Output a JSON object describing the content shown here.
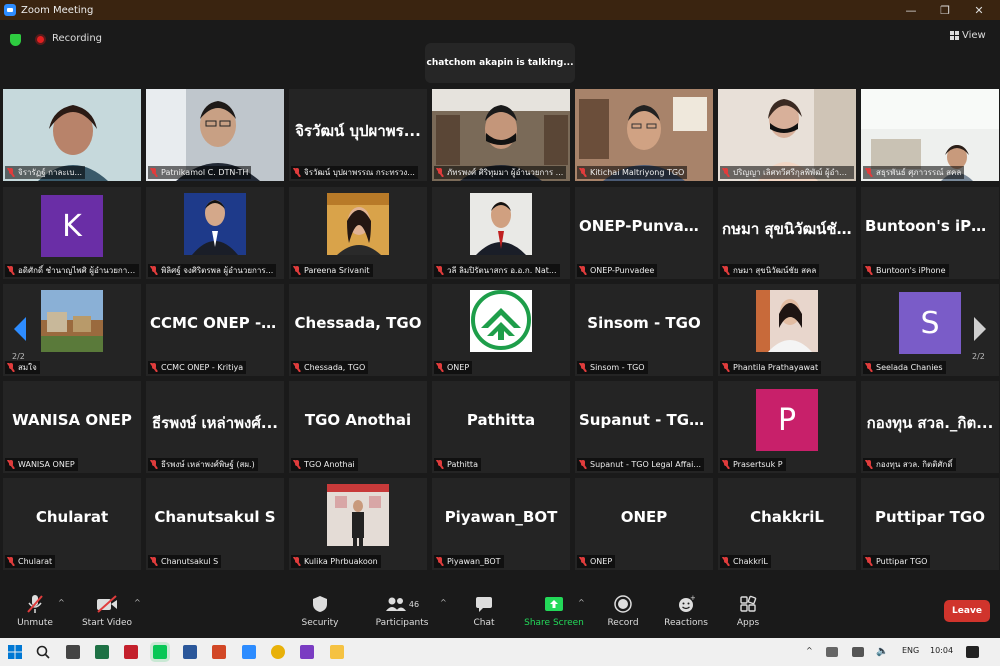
{
  "window": {
    "title": "Zoom Meeting",
    "controls": [
      "—",
      "❐",
      "✕"
    ]
  },
  "status": {
    "recording_label": "Recording",
    "talking": "chatchom akapin is talking...",
    "view_label": "View"
  },
  "pager": {
    "left_page": "2/2",
    "right_page": "2/2"
  },
  "tiles": [
    {
      "label": "จิรารัฏฐ์ กาละเบ...",
      "kind": "video",
      "scene": "woman-teal"
    },
    {
      "label": "Patnikamol C. DTN-TH",
      "kind": "video",
      "scene": "man-glasses"
    },
    {
      "label": "จิรวัฒน์ บุปผาพรรณ กระทรวง...",
      "kind": "name",
      "bigname": "จิรวัฒน์ บุปผาพร..."
    },
    {
      "label": "ภัทรพงศ์ ศิริทุมมา ผู้อำนวยการ ...",
      "kind": "video",
      "scene": "man-mask-office"
    },
    {
      "label": "Kitichai Maltriyong TGO",
      "kind": "video",
      "scene": "man-office"
    },
    {
      "label": "ปริญญา เลิศทวีศรีกุลพิพัฒ์ ผู้อำนวย...",
      "kind": "video",
      "scene": "woman-mask"
    },
    {
      "label": "สธุรพันธ์ ศุภาวรรณ์ สคล",
      "kind": "video",
      "scene": "bright-room"
    },
    {
      "label": "อดิศักดิ์ ชำนาญไพศิ ผู้อำนวยการ...",
      "kind": "avatar",
      "letter": "K",
      "color": "#6a2ea6"
    },
    {
      "label": "พิลิศฐ์ จงศิริตรพล ผู้อำนวยการ...",
      "kind": "video",
      "scene": "man-suit-blue"
    },
    {
      "label": "Pareena Srivanit",
      "kind": "video",
      "scene": "woman-orange"
    },
    {
      "label": "วลี ลิมปิรัตนาสกร อ.อ.ก. Nat...",
      "kind": "video",
      "scene": "man-suit-white"
    },
    {
      "label": "ONEP-Punvadee",
      "kind": "name",
      "bigname": "ONEP-Punvadee"
    },
    {
      "label": "กษมา สุขนิวัฒน์ชัย สคล",
      "kind": "name",
      "bigname": "กษมา สุขนิวัฒน์ชั..."
    },
    {
      "label": "Buntoon's iPhone",
      "kind": "name",
      "bigname": "Buntoon's iPhone"
    },
    {
      "label": "สมใจ",
      "kind": "video",
      "scene": "landscape"
    },
    {
      "label": "CCMC ONEP - Kritiya",
      "kind": "name",
      "bigname": "CCMC ONEP - K..."
    },
    {
      "label": "Chessada, TGO",
      "kind": "name",
      "bigname": "Chessada, TGO"
    },
    {
      "label": "ONEP",
      "kind": "logo"
    },
    {
      "label": "Sinsom - TGO",
      "kind": "name",
      "bigname": "Sinsom - TGO"
    },
    {
      "label": "Phantila Prathayawat",
      "kind": "video",
      "scene": "woman-white"
    },
    {
      "label": "Seelada Chanies",
      "kind": "avatar",
      "letter": "S",
      "color": "#7a5cc8"
    },
    {
      "label": "WANISA ONEP",
      "kind": "name",
      "bigname": "WANISA ONEP"
    },
    {
      "label": "ธีรพงษ์ เหล่าพงศ์พิษฐ์ (สผ.)",
      "kind": "name",
      "bigname": "ธีรพงษ์ เหล่าพงศ์..."
    },
    {
      "label": "TGO Anothai",
      "kind": "name",
      "bigname": "TGO Anothai"
    },
    {
      "label": "Pathitta",
      "kind": "name",
      "bigname": "Pathitta"
    },
    {
      "label": "Supanut - TGO Legal Affai...",
      "kind": "name",
      "bigname": "Supanut  - TGO..."
    },
    {
      "label": "Prasertsuk P",
      "kind": "avatar",
      "letter": "P",
      "color": "#c8206a"
    },
    {
      "label": "กองทุน สวล. กิตติศักดิ์",
      "kind": "name",
      "bigname": "กองทุน สวล._กิต..."
    },
    {
      "label": "Chularat",
      "kind": "name",
      "bigname": "Chularat"
    },
    {
      "label": "Chanutsakul S",
      "kind": "name",
      "bigname": "Chanutsakul S"
    },
    {
      "label": "Kulika Phrbuakoon",
      "kind": "video",
      "scene": "person-standing"
    },
    {
      "label": "Piyawan_BOT",
      "kind": "name",
      "bigname": "Piyawan_BOT"
    },
    {
      "label": "ONEP",
      "kind": "name",
      "bigname": "ONEP"
    },
    {
      "label": "ChakkriL",
      "kind": "name",
      "bigname": "ChakkriL"
    },
    {
      "label": "Puttipar TGO",
      "kind": "name",
      "bigname": "Puttipar TGO"
    }
  ],
  "toolbar": {
    "unmute": "Unmute",
    "start_video": "Start Video",
    "security": "Security",
    "participants": "Participants",
    "participants_count": "46",
    "chat": "Chat",
    "share_screen": "Share Screen",
    "record": "Record",
    "reactions": "Reactions",
    "apps": "Apps",
    "leave": "Leave"
  },
  "taskbar": {
    "lang": "ENG",
    "time": "10:04"
  },
  "colors": {
    "share_green": "#23d959",
    "leave_red": "#d0342c",
    "mic_off_red": "#e03c3c",
    "tile_bg": "#242424"
  }
}
